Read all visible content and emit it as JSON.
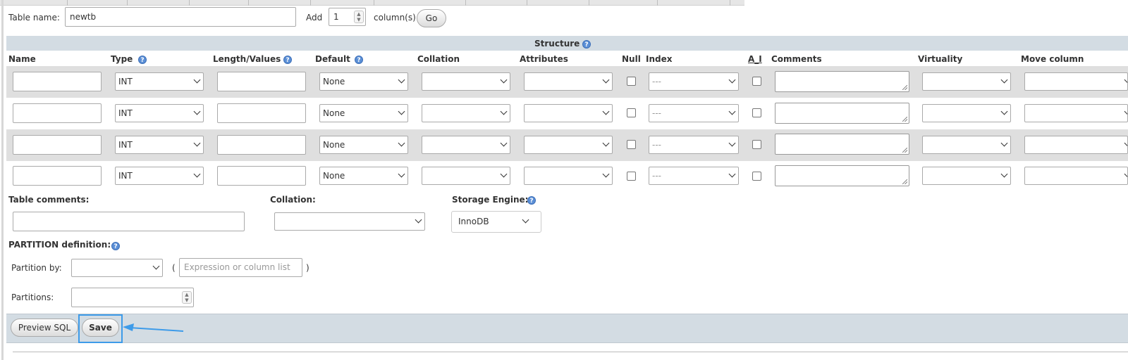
{
  "tabs_count": 11,
  "table_name": {
    "label": "Table name:",
    "value": "newtb"
  },
  "add": {
    "label": "Add",
    "value": "1",
    "suffix": "column(s)",
    "go": "Go"
  },
  "structure": {
    "title": "Structure"
  },
  "columns": {
    "name": "Name",
    "type": "Type",
    "length": "Length/Values",
    "default": "Default",
    "collation": "Collation",
    "attributes": "Attributes",
    "null": "Null",
    "index": "Index",
    "ai": "A_I",
    "comments": "Comments",
    "virtuality": "Virtuality",
    "move": "Move column"
  },
  "rows": [
    {
      "type": "INT",
      "default": "None",
      "index": "---"
    },
    {
      "type": "INT",
      "default": "None",
      "index": "---"
    },
    {
      "type": "INT",
      "default": "None",
      "index": "---"
    },
    {
      "type": "INT",
      "default": "None",
      "index": "---"
    }
  ],
  "table_comments": {
    "label": "Table comments:"
  },
  "collation_label": "Collation:",
  "storage_engine": {
    "label": "Storage Engine:",
    "value": "InnoDB"
  },
  "partition": {
    "title": "PARTITION definition:",
    "by_label": "Partition by:",
    "open_paren": "(",
    "close_paren": ")",
    "expression_placeholder": "Expression or column list",
    "partitions_label": "Partitions:"
  },
  "actions": {
    "preview": "Preview SQL",
    "save": "Save"
  },
  "colors": {
    "bar": "#d3dce3",
    "row_shade": "#dfdfdf",
    "highlight": "#3d9be9"
  }
}
